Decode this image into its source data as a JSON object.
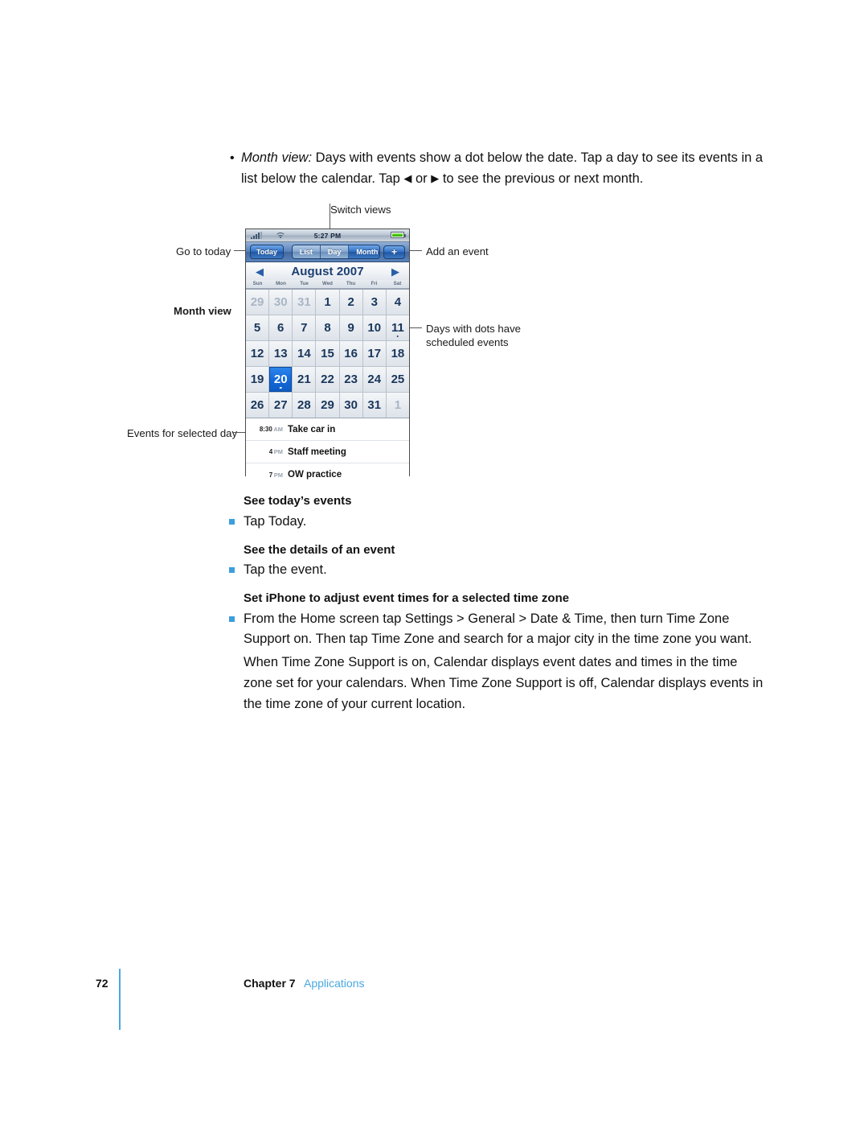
{
  "intro": {
    "bullet_mark": "•",
    "lead_italic": "Month view:",
    "text_part1": "  Days with events show a dot below the date. Tap a day to see its events in a list below the calendar. Tap ",
    "prev_arrow": "◀",
    "text_or": " or ",
    "next_arrow": "▶",
    "text_part2": " to see the previous or next month."
  },
  "annotations": {
    "switch_views": "Switch views",
    "go_to_today": "Go to today",
    "month_view": "Month view",
    "add_an_event": "Add an event",
    "days_with_dots": "Days with dots have scheduled events",
    "events_for_selected_day": "Events for selected day"
  },
  "device": {
    "statusbar": {
      "signal_icon": "signal-bars-icon",
      "wifi_icon": "wifi-icon",
      "time": "5:27 PM",
      "battery_icon": "battery-icon"
    },
    "toolbar": {
      "today_label": "Today",
      "segments": [
        {
          "label": "List",
          "active": false
        },
        {
          "label": "Day",
          "active": false
        },
        {
          "label": "Month",
          "active": true
        }
      ],
      "add_label": "+"
    },
    "month_header": {
      "prev_icon": "◀",
      "title": "August 2007",
      "next_icon": "▶"
    },
    "weekdays": [
      "Sun",
      "Mon",
      "Tue",
      "Wed",
      "Thu",
      "Fri",
      "Sat"
    ],
    "days": [
      {
        "n": "29",
        "other": true
      },
      {
        "n": "30",
        "other": true
      },
      {
        "n": "31",
        "other": true
      },
      {
        "n": "1"
      },
      {
        "n": "2"
      },
      {
        "n": "3"
      },
      {
        "n": "4"
      },
      {
        "n": "5"
      },
      {
        "n": "6"
      },
      {
        "n": "7"
      },
      {
        "n": "8"
      },
      {
        "n": "9"
      },
      {
        "n": "10"
      },
      {
        "n": "11",
        "dot": true
      },
      {
        "n": "12"
      },
      {
        "n": "13"
      },
      {
        "n": "14"
      },
      {
        "n": "15"
      },
      {
        "n": "16"
      },
      {
        "n": "17"
      },
      {
        "n": "18"
      },
      {
        "n": "19"
      },
      {
        "n": "20",
        "selected": true,
        "dot": true
      },
      {
        "n": "21"
      },
      {
        "n": "22"
      },
      {
        "n": "23"
      },
      {
        "n": "24"
      },
      {
        "n": "25"
      },
      {
        "n": "26"
      },
      {
        "n": "27"
      },
      {
        "n": "28"
      },
      {
        "n": "29"
      },
      {
        "n": "30"
      },
      {
        "n": "31"
      },
      {
        "n": "1",
        "other": true
      }
    ],
    "events": [
      {
        "time": "8:30",
        "meridiem": "AM",
        "title": "Take car in"
      },
      {
        "time": "4",
        "meridiem": "PM",
        "title": "Staff meeting"
      },
      {
        "time": "7",
        "meridiem": "PM",
        "title": "OW practice"
      }
    ]
  },
  "sections": [
    {
      "heading": "See today’s events",
      "bullet": "Tap Today."
    },
    {
      "heading": "See the details of an event",
      "bullet": "Tap the event."
    },
    {
      "heading": "Set iPhone to adjust event times for a selected time zone",
      "bullet": "From the Home screen tap Settings > General > Date & Time, then turn Time Zone Support on. Then tap Time Zone and search for a major city in the time zone you want."
    }
  ],
  "closing_paragraph": "When Time Zone Support is on, Calendar displays event dates and times in the time zone set for your calendars. When Time Zone Support is off, Calendar displays events in the time zone of your current location.",
  "footer": {
    "page_number": "72",
    "chapter": "Chapter 7",
    "section": "Applications"
  },
  "colors": {
    "accent_blue": "#4aa8e0",
    "bullet_blue": "#3c9ede",
    "selected_day": "#1268d8"
  }
}
